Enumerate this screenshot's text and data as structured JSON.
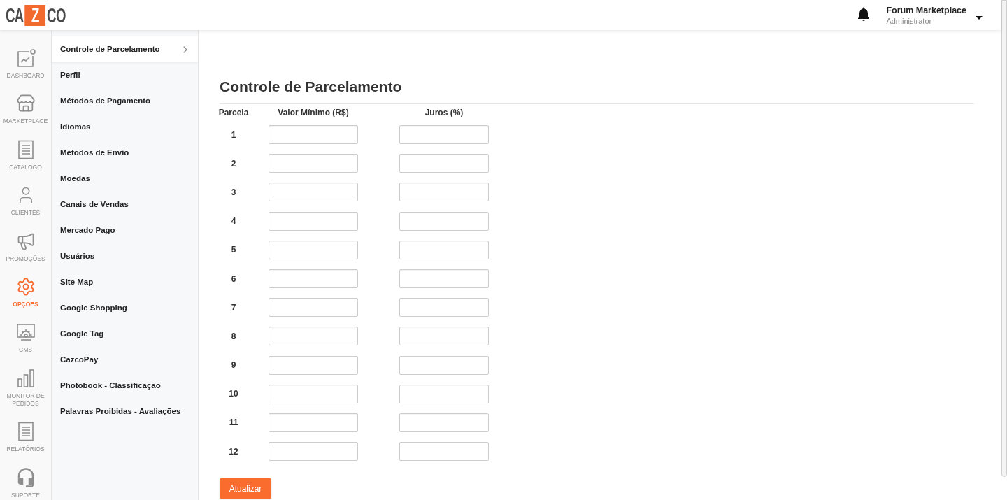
{
  "header": {
    "logo": {
      "left": "CA",
      "mark": "Z",
      "right": "CO"
    },
    "user": {
      "name": "Forum Marketplace",
      "role": "Administrator"
    }
  },
  "nav_rail": {
    "items": [
      {
        "label": "DASHBOARD",
        "selected": false
      },
      {
        "label": "MARKETPLACE",
        "selected": false
      },
      {
        "label": "CATÁLOGO",
        "selected": false
      },
      {
        "label": "CLIENTES",
        "selected": false
      },
      {
        "label": "PROMOÇÕES",
        "selected": false
      },
      {
        "label": "OPÇÕES",
        "selected": true
      },
      {
        "label": "CMS",
        "selected": false
      },
      {
        "label": "MONITOR DE PEDIDOS",
        "selected": false
      },
      {
        "label": "RELATÓRIOS",
        "selected": false
      },
      {
        "label": "SUPORTE",
        "selected": false
      }
    ]
  },
  "submenu": {
    "items": [
      {
        "label": "Controle de Parcelamento",
        "selected": true
      },
      {
        "label": "Perfil",
        "selected": false
      },
      {
        "label": "Métodos de Pagamento",
        "selected": false
      },
      {
        "label": "Idiomas",
        "selected": false
      },
      {
        "label": "Métodos de Envio",
        "selected": false
      },
      {
        "label": "Moedas",
        "selected": false
      },
      {
        "label": "Canais de Vendas",
        "selected": false
      },
      {
        "label": "Mercado Pago",
        "selected": false
      },
      {
        "label": "Usuários",
        "selected": false
      },
      {
        "label": "Site Map",
        "selected": false
      },
      {
        "label": "Google Shopping",
        "selected": false
      },
      {
        "label": "Google Tag",
        "selected": false
      },
      {
        "label": "CazcoPay",
        "selected": false
      },
      {
        "label": "Photobook - Classificação",
        "selected": false
      },
      {
        "label": "Palavras Proibidas - Avaliações",
        "selected": false
      }
    ]
  },
  "page": {
    "title": "Controle de Parcelamento",
    "columns": [
      "Parcela",
      "Valor Mínimo (R$)",
      "Juros (%)"
    ],
    "rows": [
      "1",
      "2",
      "3",
      "4",
      "5",
      "6",
      "7",
      "8",
      "9",
      "10",
      "11",
      "12"
    ],
    "submit": "Atualizar"
  }
}
